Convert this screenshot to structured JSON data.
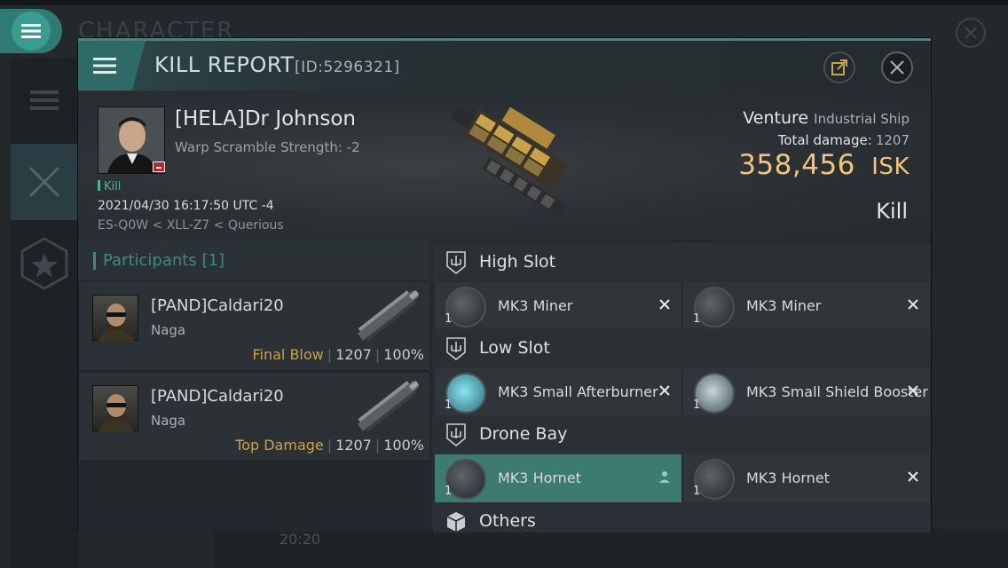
{
  "background": {
    "title": "CHARACTER",
    "stat_value": "20:20"
  },
  "window": {
    "title": "KILL REPORT",
    "id_label": "[ID:5296321]"
  },
  "victim": {
    "name": "[HELA]Dr Johnson",
    "warp_scramble": "Warp Scramble Strength: -2",
    "tag": "Kill",
    "datetime": "2021/04/30 16:17:50 UTC -4",
    "location": "ES-Q0W < XLL-Z7 < Querious",
    "ship": "Venture",
    "ship_class": "Industrial Ship",
    "damage_label": "Total damage:",
    "damage_value": "1207",
    "isk_value": "358,456",
    "isk_unit": "ISK",
    "result": "Kill"
  },
  "participants": {
    "title": "Participants",
    "count": "[1]",
    "rows": [
      {
        "name": "[PAND]Caldari20",
        "ship": "Naga",
        "label": "Final Blow",
        "damage": "1207",
        "percent": "100%"
      },
      {
        "name": "[PAND]Caldari20",
        "ship": "Naga",
        "label": "Top Damage",
        "damage": "1207",
        "percent": "100%"
      }
    ]
  },
  "fitting": {
    "high": {
      "title": "High Slot",
      "modules": [
        {
          "name": "MK3 Miner",
          "qty": "1"
        },
        {
          "name": "MK3 Miner",
          "qty": "1"
        }
      ]
    },
    "low": {
      "title": "Low Slot",
      "modules": [
        {
          "name": "MK3 Small Afterburner",
          "qty": "1"
        },
        {
          "name": "MK3 Small Shield Booster",
          "qty": "1"
        }
      ]
    },
    "drone": {
      "title": "Drone Bay",
      "modules": [
        {
          "name": "MK3 Hornet",
          "qty": "1"
        },
        {
          "name": "MK3 Hornet",
          "qty": "1"
        }
      ]
    },
    "others": {
      "title": "Others"
    }
  },
  "colors": {
    "accent": "#3f8a80",
    "isk": "#f3c57a",
    "final_blow": "#c9a24a",
    "kill_tag": "#4fb596"
  }
}
